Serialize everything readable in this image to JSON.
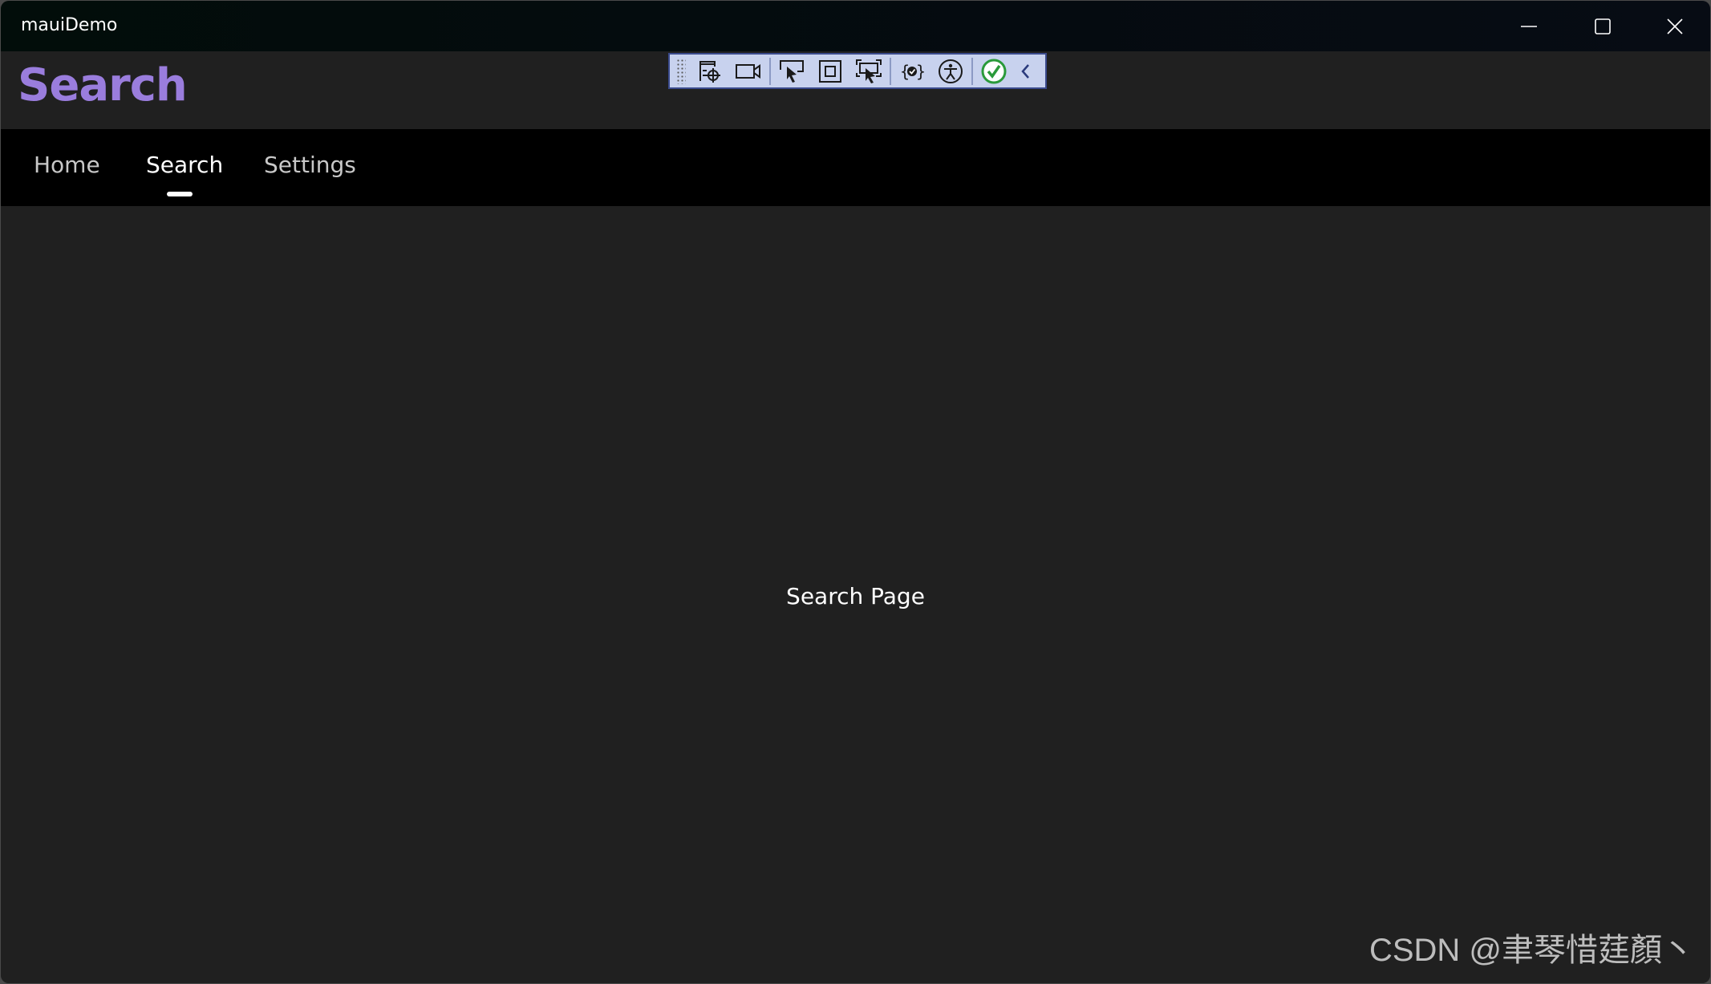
{
  "window": {
    "title": "mauiDemo",
    "controls": {
      "minimize_icon": "minimize-icon",
      "maximize_icon": "maximize-icon",
      "close_icon": "close-icon"
    }
  },
  "header": {
    "title": "Search",
    "title_color": "#9a7ddd"
  },
  "dev_toolbar": {
    "items": [
      {
        "name": "go-to-live-visual-tree",
        "icon": "live-visual-tree-icon"
      },
      {
        "name": "toggle-in-app-recording",
        "icon": "video-camera-icon"
      },
      {
        "name": "select-element",
        "icon": "select-element-icon"
      },
      {
        "name": "display-layout-adorners",
        "icon": "layout-adorner-icon"
      },
      {
        "name": "track-focused-element",
        "icon": "track-focus-icon"
      },
      {
        "name": "binding-failures",
        "icon": "binding-check-icon"
      },
      {
        "name": "accessibility-checker",
        "icon": "accessibility-icon"
      },
      {
        "name": "hot-reload-status",
        "icon": "check-circle-icon"
      },
      {
        "name": "collapse-toolbar",
        "icon": "chevron-left-icon"
      }
    ]
  },
  "tabs": [
    {
      "label": "Home",
      "active": false
    },
    {
      "label": "Search",
      "active": true
    },
    {
      "label": "Settings",
      "active": false
    }
  ],
  "content": {
    "label": "Search Page"
  },
  "watermark": "CSDN @聿琴惜莛顏丶"
}
